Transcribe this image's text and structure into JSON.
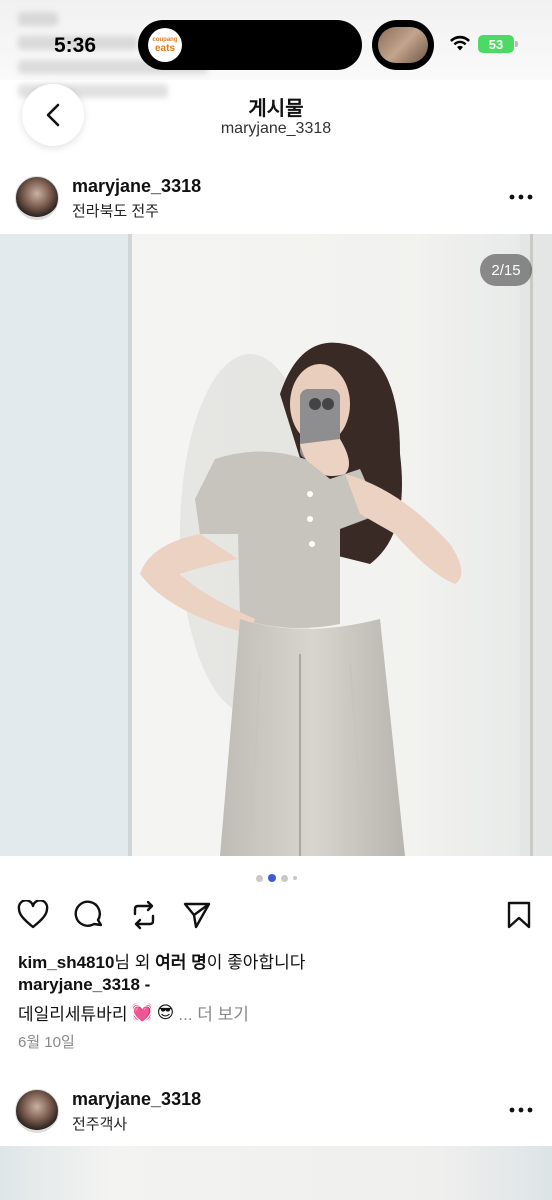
{
  "status": {
    "time": "5:36",
    "battery": "53",
    "island_app_top": "coupang",
    "island_app_bottom": "eats"
  },
  "header": {
    "title": "게시물",
    "subtitle": "maryjane_3318"
  },
  "post": {
    "username": "maryjane_3318",
    "location": "전라북도 전주",
    "counter": "2/15",
    "likes_user": "kim_sh4810",
    "likes_rest": "님 외 ",
    "likes_bold": "여러 명",
    "likes_tail": "이 좋아합니다",
    "caption_user": "maryjane_3318 -",
    "caption_text": "데일리세튜바리",
    "caption_emoji1": "💓",
    "caption_emoji2": "😎",
    "caption_more": "... 더 보기",
    "date": "6월 10일"
  },
  "next_post": {
    "username": "maryjane_3318",
    "location": "전주객사"
  },
  "colors": {
    "accent_dot": "#3d5ad6",
    "battery": "#4cd964"
  }
}
